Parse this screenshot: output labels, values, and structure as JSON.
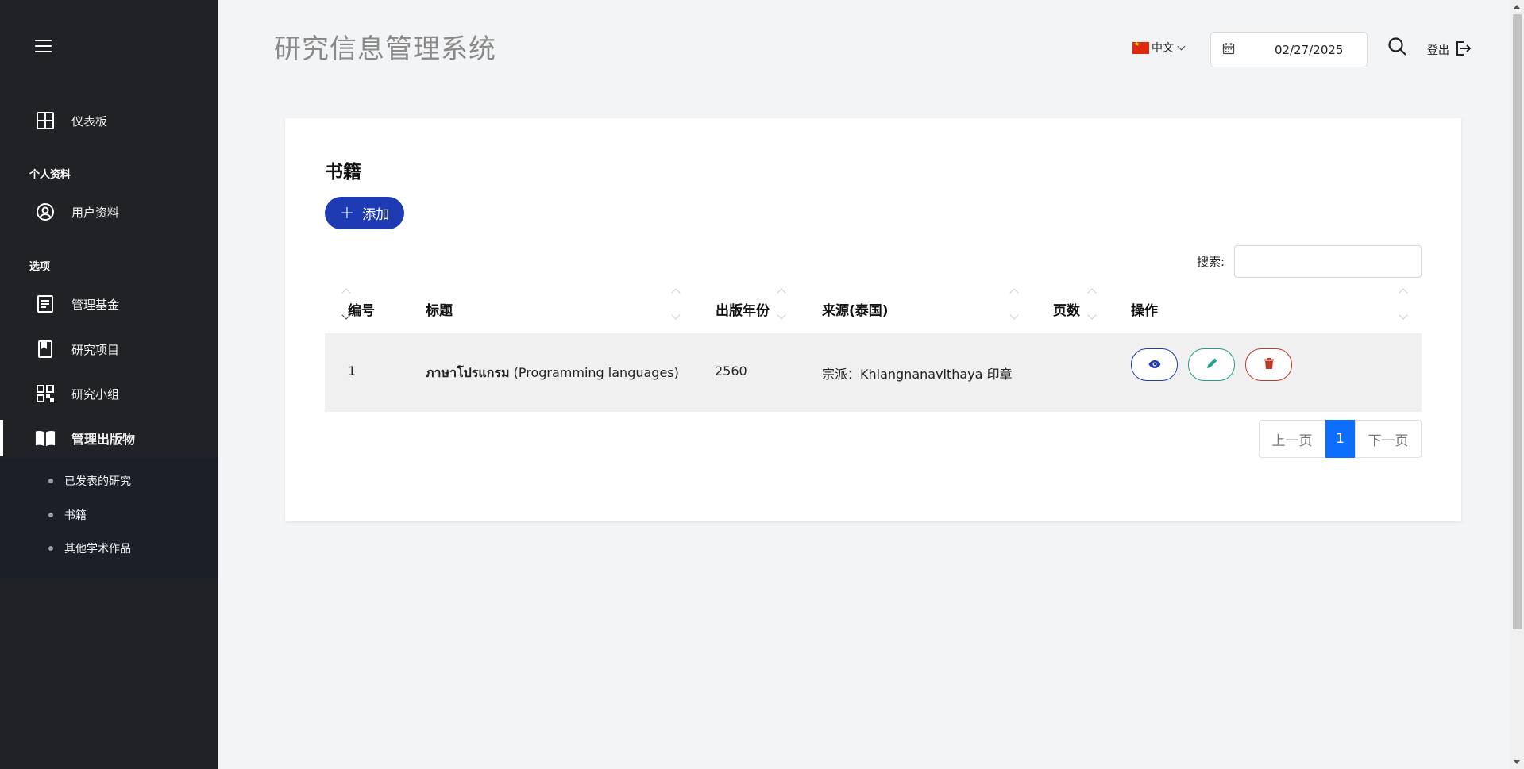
{
  "header": {
    "app_title": "研究信息管理系统",
    "language": "中文",
    "date": "02/27/2025",
    "logout": "登出"
  },
  "sidebar": {
    "dashboard": "仪表板",
    "section_profile": "个人资料",
    "user_profile": "用户资料",
    "section_options": "选项",
    "manage_funds": "管理基金",
    "research_projects": "研究项目",
    "research_groups": "研究小组",
    "manage_publications": "管理出版物",
    "sub_items": [
      "已发表的研究",
      "书籍",
      "其他学术作品"
    ]
  },
  "card": {
    "title": "书籍",
    "add_label": "添加",
    "search_label": "搜索:",
    "search_value": ""
  },
  "table": {
    "columns": [
      "编号",
      "标题",
      "出版年份",
      "来源(泰国)",
      "页数",
      "操作"
    ],
    "rows": [
      {
        "id": "1",
        "title_thai": "ภาษาโปรแกรม",
        "title_en": " (Programming languages)",
        "year": "2560",
        "source": "宗派：Khlangnanavithaya 印章",
        "pages": ""
      }
    ]
  },
  "pagination": {
    "prev": "上一页",
    "current": "1",
    "next": "下一页"
  },
  "colors": {
    "sidebar_bg": "#212226",
    "primary": "#1f3bb3",
    "page_active": "#0d6efd",
    "edit": "#20a08a",
    "delete": "#c0392b"
  }
}
